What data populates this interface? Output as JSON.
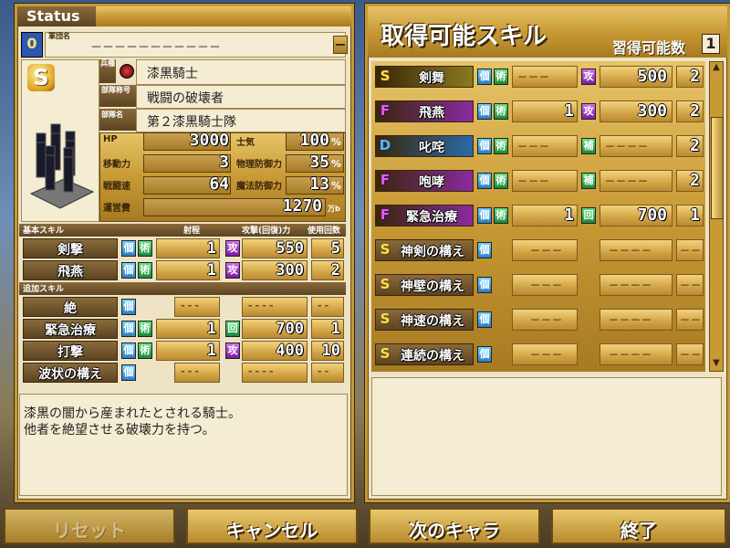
{
  "status_title": "Status",
  "army_label": "軍団名",
  "army_value": "－－－－－－－－－－－",
  "rank": "S",
  "class_label": "兵種",
  "class_value": "漆黒騎士",
  "unit_title_label": "部隊称号",
  "unit_title_value": "戦闘の破壊者",
  "unit_name_label": "部隊名",
  "unit_name_value": "第２漆黒騎士隊",
  "stats": [
    {
      "label": "HP",
      "value": "3000"
    },
    {
      "label": "士気",
      "value": "100",
      "unit": "%"
    },
    {
      "label": "移動力",
      "value": "3"
    },
    {
      "label": "物理防御力",
      "value": "35",
      "unit": "%"
    },
    {
      "label": "戦闘速",
      "value": "64"
    },
    {
      "label": "魔法防御力",
      "value": "13",
      "unit": "%"
    },
    {
      "label": "運営費",
      "value": "1270",
      "unit": "万b"
    }
  ],
  "basic_skill_header": "基本スキル",
  "col_range": "射程",
  "col_power": "攻撃(回復)力",
  "col_uses": "使用回数",
  "basic_skills": [
    {
      "name": "剣撃",
      "range": "1",
      "type": "攻",
      "power": "550",
      "uses": "5"
    },
    {
      "name": "飛燕",
      "range": "1",
      "type": "攻",
      "power": "300",
      "uses": "2"
    }
  ],
  "extra_skill_header": "追加スキル",
  "extra_skills": [
    {
      "name": "絶",
      "range": "",
      "type": "",
      "power": "",
      "uses": ""
    },
    {
      "name": "緊急治療",
      "range": "1",
      "type": "回",
      "power": "700",
      "uses": "1"
    },
    {
      "name": "打撃",
      "range": "1",
      "type": "攻",
      "power": "400",
      "uses": "10"
    },
    {
      "name": "波状の構え",
      "range": "",
      "type": "",
      "power": "",
      "uses": ""
    }
  ],
  "description_line1": "漆黒の闇から産まれたとされる騎士。",
  "description_line2": "他者を絶望させる破壊力を持つ。",
  "acquirable_title": "取得可能スキル",
  "learnable_label": "習得可能数",
  "learnable_count": "1",
  "acquirable_skills": [
    {
      "rank": "S",
      "name": "剣舞",
      "range": "－－－",
      "type": "攻",
      "power": "500",
      "uses": "2",
      "color": "#8a7a22"
    },
    {
      "rank": "F",
      "name": "飛燕",
      "range": "1",
      "type": "攻",
      "power": "300",
      "uses": "2",
      "color": "#8a2aa0"
    },
    {
      "rank": "D",
      "name": "叱咤",
      "range": "－－－",
      "type": "補",
      "power": "－－－－",
      "uses": "2",
      "color": "#2a6aa8"
    },
    {
      "rank": "F",
      "name": "咆哮",
      "range": "－－－",
      "type": "補",
      "power": "－－－－",
      "uses": "2",
      "color": "#8a2aa0"
    },
    {
      "rank": "F",
      "name": "緊急治療",
      "range": "1",
      "type": "回",
      "power": "700",
      "uses": "1",
      "color": "#8a2aa0"
    },
    {
      "rank": "S",
      "name": "神剣の構え",
      "range": "－－－",
      "type": "",
      "power": "－－－－",
      "uses": "－－",
      "color": ""
    },
    {
      "rank": "S",
      "name": "神壁の構え",
      "range": "－－－",
      "type": "",
      "power": "－－－－",
      "uses": "－－",
      "color": ""
    },
    {
      "rank": "S",
      "name": "神速の構え",
      "range": "－－－",
      "type": "",
      "power": "－－－－",
      "uses": "－－",
      "color": ""
    },
    {
      "rank": "S",
      "name": "連続の構え",
      "range": "－－－",
      "type": "",
      "power": "－－－－",
      "uses": "－－",
      "color": ""
    }
  ],
  "tag_ret": "個",
  "tag_fw": "術",
  "buttons": {
    "reset": "リセット",
    "cancel": "キャンセル",
    "next": "次のキャラ",
    "end": "終了"
  }
}
